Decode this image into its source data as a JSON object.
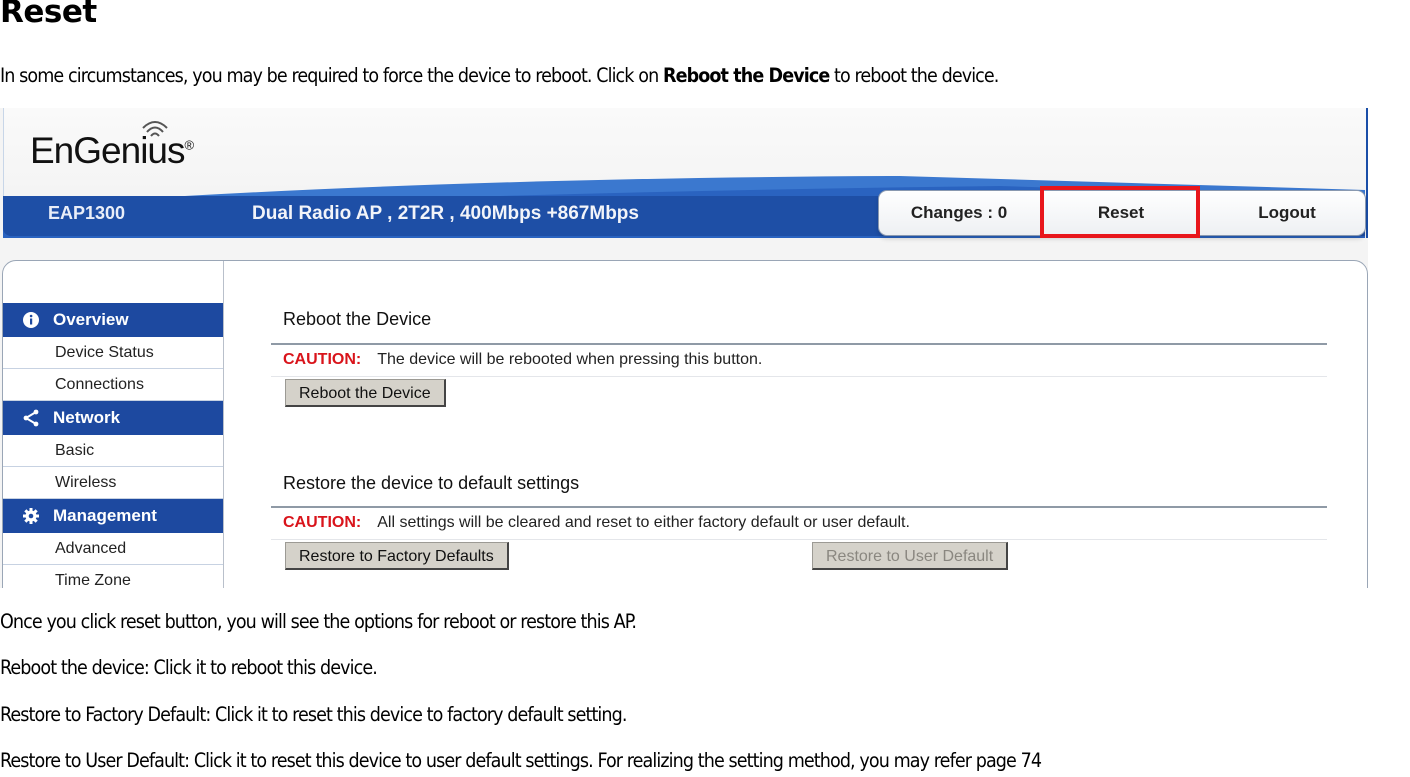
{
  "doc": {
    "title": "Reset",
    "intro_before": "In some circumstances, you may be required to force the device to reboot. Click on ",
    "intro_bold": "Reboot the Device",
    "intro_after": " to reboot the device.",
    "para1": "Once you click reset button, you will see the options for reboot or restore this AP.",
    "para2": "Reboot the device: Click it to reboot this device.",
    "para3": "Restore to Factory Default: Click it to reset this device to factory default setting.",
    "para4": "Restore to User Default: Click it to reset this device to user default settings. For realizing the setting method, you may refer page 74"
  },
  "ui": {
    "brand": "EnGenius",
    "brand_mark": "®",
    "model": "EAP1300",
    "tagline": "Dual Radio AP , 2T2R , 400Mbps +867Mbps",
    "tabs": {
      "changes": "Changes : 0",
      "reset": "Reset",
      "logout": "Logout"
    },
    "highlight_color": "#e8161c",
    "accent_color": "#1d49a0",
    "sidebar": [
      {
        "section": "Overview",
        "icon": "info-icon",
        "items": [
          "Device Status",
          "Connections"
        ]
      },
      {
        "section": "Network",
        "icon": "share-icon",
        "items": [
          "Basic",
          "Wireless"
        ]
      },
      {
        "section": "Management",
        "icon": "gear-icon",
        "items": [
          "Advanced",
          "Time Zone"
        ]
      }
    ],
    "reboot": {
      "title": "Reboot the Device",
      "caution_label": "CAUTION:",
      "caution_text": "The device will be rebooted when pressing this button.",
      "button": "Reboot the Device"
    },
    "restore": {
      "title": "Restore the device to default settings",
      "caution_label": "CAUTION:",
      "caution_text": "All settings will be cleared and reset to either factory default or user default.",
      "factory_button": "Restore to Factory Defaults",
      "user_button": "Restore to User Default"
    }
  }
}
